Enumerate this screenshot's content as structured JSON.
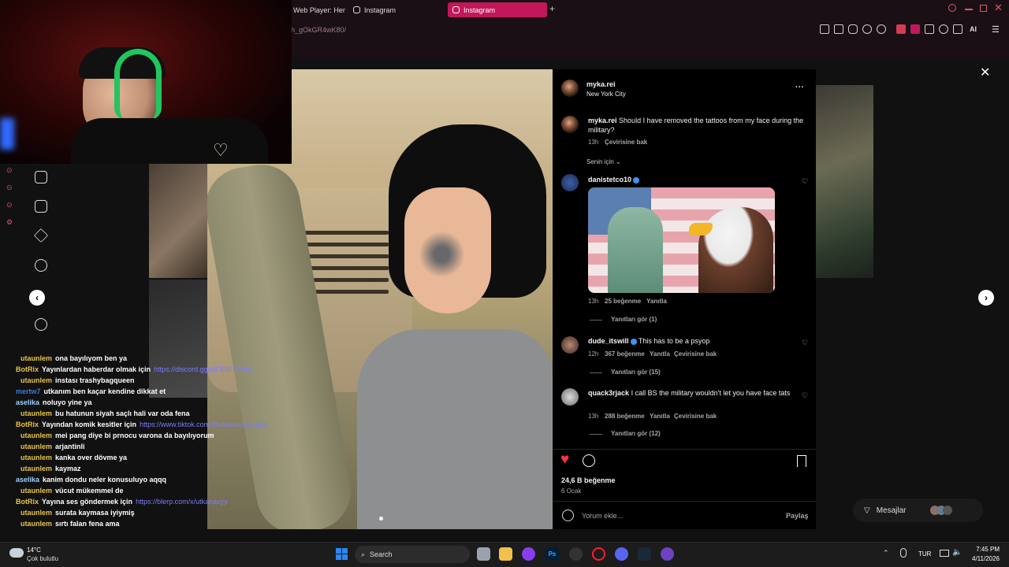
{
  "browser": {
    "tabs": [
      {
        "label": "Web Player: Her"
      },
      {
        "label": "Instagram"
      },
      {
        "label": "Instagram"
      }
    ],
    "new_tab": "+",
    "url": "h_gOkGR4wK80/",
    "ai_label": "AI"
  },
  "post": {
    "author": "myka.rei",
    "location": "New York City",
    "more": "...",
    "caption": {
      "user": "myka.rei",
      "text": "Should I have removed the tattoos from my face during the military?",
      "time": "13h",
      "translate": "Çevirisine bak"
    },
    "filter": "Senin için",
    "comments": [
      {
        "user": "danistetco10",
        "text": "",
        "time": "13h",
        "likes": "25 beğenme",
        "reply": "Yanıtla",
        "translate": "",
        "replies": "Yanıtları gör (1)"
      },
      {
        "user": "dude_itswill",
        "text": "This has to be a psyop",
        "time": "12h",
        "likes": "367 beğenme",
        "reply": "Yanıtla",
        "translate": "Çevirisine bak",
        "replies": "Yanıtları gör (15)"
      },
      {
        "user": "quack3rjack",
        "text": "I call BS the military wouldn't let you have face tats",
        "time": "13h",
        "likes": "288 beğenme",
        "reply": "Yanıtla",
        "translate": "Çevirisine bak",
        "replies": "Yanıtları gör (12)"
      }
    ],
    "likes": "24,6 B beğenme",
    "date": "6 Ocak",
    "comment_placeholder": "Yorum ekle...",
    "share": "Paylaş"
  },
  "messages": {
    "label": "Mesajlar"
  },
  "chat": [
    {
      "name": "utaunlem",
      "color": "#e8c547",
      "msg": "ona bayılıyom ben ya"
    },
    {
      "name": "BotRix",
      "color": "#e8c547",
      "msg": "Yayınlardan haberdar olmak için",
      "link": "https://discord.gg/pjFB8EaPm4"
    },
    {
      "name": "utaunlem",
      "color": "#e8c547",
      "msg": "instası trashybagqueen"
    },
    {
      "name": "mertw7",
      "color": "#3e7bd6",
      "msg": "utkanım ben kaçar kendine dikkat et"
    },
    {
      "name": "aselika",
      "color": "#9ad1ff",
      "msg": "noluyo yine ya"
    },
    {
      "name": "utaunlem",
      "color": "#e8c547",
      "msg": "bu hatunun siyah saçlı hali var oda fena"
    },
    {
      "name": "BotRix",
      "color": "#e8c547",
      "msg": "Yayından komik kesitler için",
      "link": "https://www.tiktok.com/@utkanaxyy.kesit"
    },
    {
      "name": "utaunlem",
      "color": "#e8c547",
      "msg": "mei pang diye bi prnocu varona da bayılıyorum"
    },
    {
      "name": "utaunlem",
      "color": "#e8c547",
      "msg": "arjantinli"
    },
    {
      "name": "utaunlem",
      "color": "#e8c547",
      "msg": "kanka over dövme ya"
    },
    {
      "name": "utaunlem",
      "color": "#e8c547",
      "msg": "kaymaz"
    },
    {
      "name": "aselika",
      "color": "#9ad1ff",
      "msg": "kanim dondu neler konusuluyo aqqq"
    },
    {
      "name": "utaunlem",
      "color": "#e8c547",
      "msg": "vücut mükemmel de"
    },
    {
      "name": "BotRix",
      "color": "#e8c547",
      "msg": "Yayına ses göndermek için",
      "link": "https://blerp.com/x/utkanaxyy"
    },
    {
      "name": "utaunlem",
      "color": "#e8c547",
      "msg": "surata kaymasa iyiymiş"
    },
    {
      "name": "utaunlem",
      "color": "#e8c547",
      "msg": "sırtı falan fena ama"
    }
  ],
  "taskbar": {
    "weather_temp": "14°C",
    "weather_desc": "Çok bulutlu",
    "search": "Search",
    "lang": "TUR",
    "time": "7:45 PM",
    "date": "4/11/2026"
  }
}
